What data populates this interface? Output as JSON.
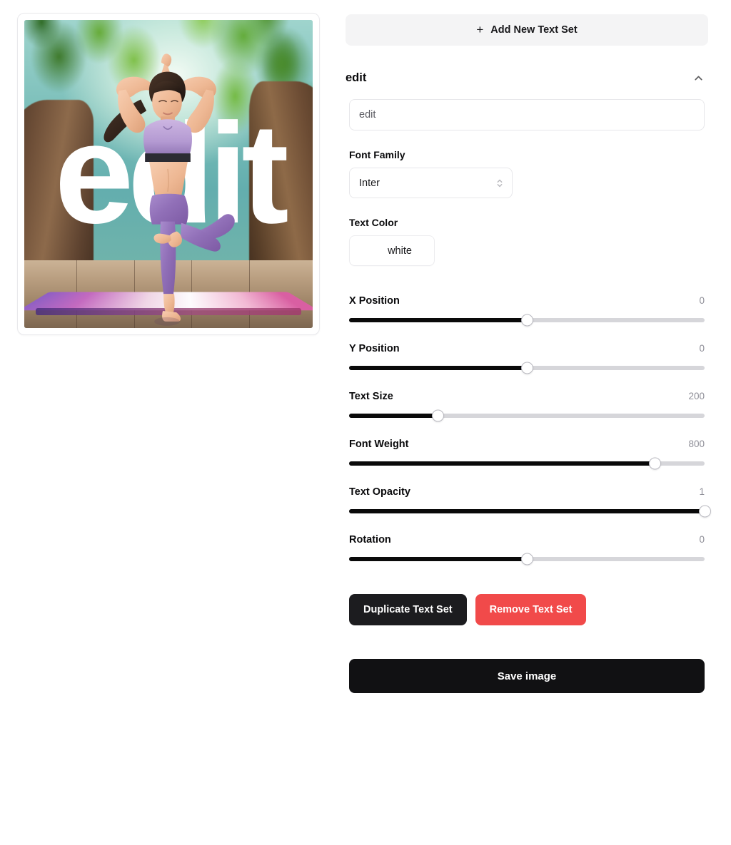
{
  "preview": {
    "overlay_text": "edit",
    "image_description": "woman in yoga tree pose in a sunlit forest on a purple-pink yoga mat"
  },
  "panel": {
    "add_text_set": {
      "label": "Add New Text Set",
      "icon": "plus-icon"
    },
    "text_set": {
      "title": "edit",
      "collapse_icon": "chevron-up-icon",
      "text_input": {
        "value": "edit",
        "placeholder": "edit"
      },
      "font_family": {
        "label": "Font Family",
        "value": "Inter",
        "icon": "chevron-up-down-icon"
      },
      "text_color": {
        "label": "Text Color",
        "value": "white",
        "swatch": "#ffffff"
      },
      "sliders": [
        {
          "label": "X Position",
          "value": "0",
          "percent": 50
        },
        {
          "label": "Y Position",
          "value": "0",
          "percent": 50
        },
        {
          "label": "Text Size",
          "value": "200",
          "percent": 25
        },
        {
          "label": "Font Weight",
          "value": "800",
          "percent": 86
        },
        {
          "label": "Text Opacity",
          "value": "1",
          "percent": 100
        },
        {
          "label": "Rotation",
          "value": "0",
          "percent": 50
        }
      ],
      "duplicate_label": "Duplicate Text Set",
      "remove_label": "Remove Text Set"
    },
    "save_label": "Save image"
  },
  "colors": {
    "accent_dark": "#111113",
    "danger": "#f14a4a",
    "muted_bg": "#f4f4f5",
    "track": "#d6d6da",
    "track_fill": "#0a0a0a"
  }
}
